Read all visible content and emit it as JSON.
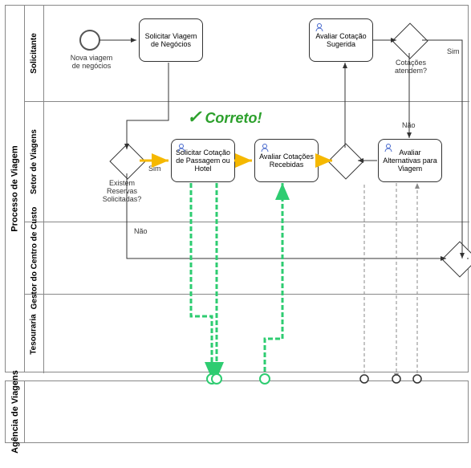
{
  "pool1_title": "Processo de Viagem",
  "pool2_title": "Agência de Viagens",
  "lanes": {
    "l1": "Solicitante",
    "l2": "Setor de Viagens",
    "l3": "Gestor do Centro de Custo",
    "l4": "Tesouraria"
  },
  "start_label": "Nova viagem de negócios",
  "tasks": {
    "t1": "Solicitar Viagem de Negócios",
    "t2": "Avaliar Cotação Sugerida",
    "t3": "Solicitar Cotação de Passagem ou Hotel",
    "t4": "Avaliar Cotações Recebidas",
    "t5": "Avaliar Alternativas para Viagem"
  },
  "gateway_labels": {
    "g1": "Existem Reservas Solicitadas?",
    "g2": "Cotações atendem?"
  },
  "flow_labels": {
    "sim": "Sim",
    "nao": "Não",
    "sim2": "Sim"
  },
  "annotation": "Correto!"
}
